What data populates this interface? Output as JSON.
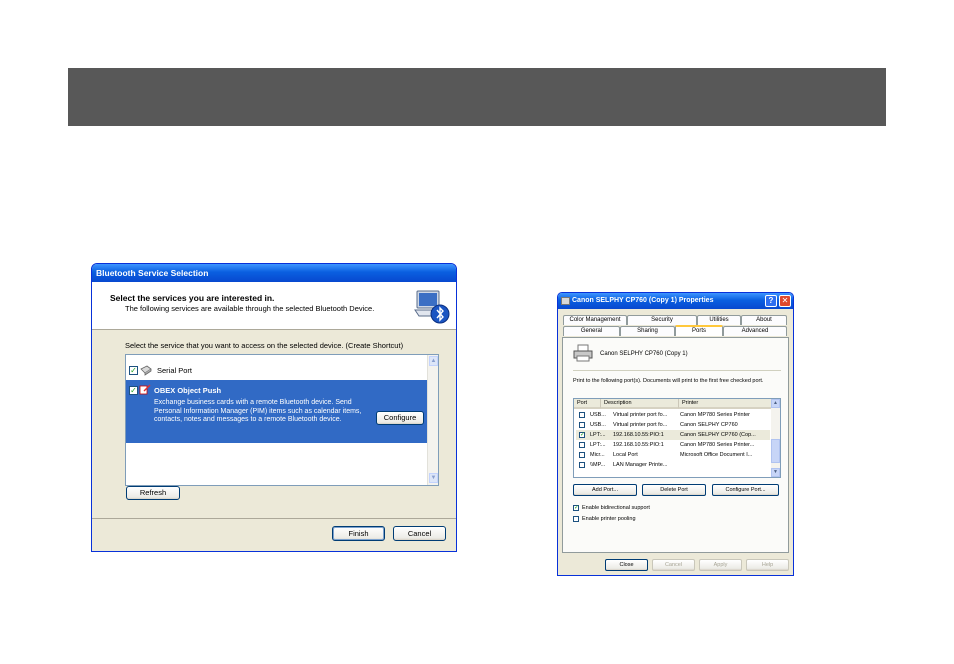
{
  "bluetooth_dialog": {
    "title": "Bluetooth Service Selection",
    "header_title": "Select the services you are interested in.",
    "header_subtitle": "The following services are available through the selected Bluetooth Device.",
    "instruction": "Select the service that you want to access on the selected device. (Create Shortcut)",
    "services": [
      {
        "name": "Serial Port",
        "checked": true
      },
      {
        "name": "OBEX Object Push",
        "checked": true,
        "description": "Exchange business cards with a remote Bluetooth device. Send Personal Information Manager (PIM) items such as calendar items, contacts, notes and messages to a remote Bluetooth device."
      }
    ],
    "configure_label": "Configure",
    "refresh_label": "Refresh",
    "finish_label": "Finish",
    "cancel_label": "Cancel",
    "checkmark": "✓"
  },
  "printer_dialog": {
    "title": "Canon SELPHY CP760 (Copy 1) Properties",
    "help_glyph": "?",
    "close_glyph": "✕",
    "tabs_row1": [
      "Color Management",
      "Security",
      "Utilities",
      "About"
    ],
    "tabs_row2": [
      "General",
      "Sharing",
      "Ports",
      "Advanced"
    ],
    "active_tab": "Ports",
    "printer_name": "Canon SELPHY CP760 (Copy 1)",
    "instruction": "Print to the following port(s). Documents will print to the first free checked port.",
    "columns": [
      "Port",
      "Description",
      "Printer"
    ],
    "ports": [
      {
        "port": "USB...",
        "description": "Virtual printer port fo...",
        "printer": "Canon MP780 Series Printer",
        "checked": false,
        "selected": false
      },
      {
        "port": "USB...",
        "description": "Virtual printer port fo...",
        "printer": "Canon SELPHY CP760",
        "checked": false,
        "selected": false
      },
      {
        "port": "LPT:...",
        "description": "192.168.10.55:PIO:1",
        "printer": "Canon SELPHY CP760 (Cop...",
        "checked": true,
        "selected": true
      },
      {
        "port": "LPT:...",
        "description": "192.168.10.55:PIO:1",
        "printer": "Canon MP780 Series Printer...",
        "checked": false,
        "selected": false
      },
      {
        "port": "Micr...",
        "description": "Local Port",
        "printer": "Microsoft Office Document I...",
        "checked": false,
        "selected": false
      },
      {
        "port": "\\\\MP...",
        "description": "LAN Manager Printe...",
        "printer": "",
        "checked": false,
        "selected": false
      }
    ],
    "add_port_label": "Add Port...",
    "delete_port_label": "Delete Port",
    "configure_port_label": "Configure Port...",
    "bidirectional_label": "Enable bidirectional support",
    "bidirectional_checked": true,
    "pooling_label": "Enable printer pooling",
    "pooling_checked": false,
    "close_label": "Close",
    "cancel_label": "Cancel",
    "apply_label": "Apply",
    "help_label": "Help",
    "checkmark": "✓"
  }
}
